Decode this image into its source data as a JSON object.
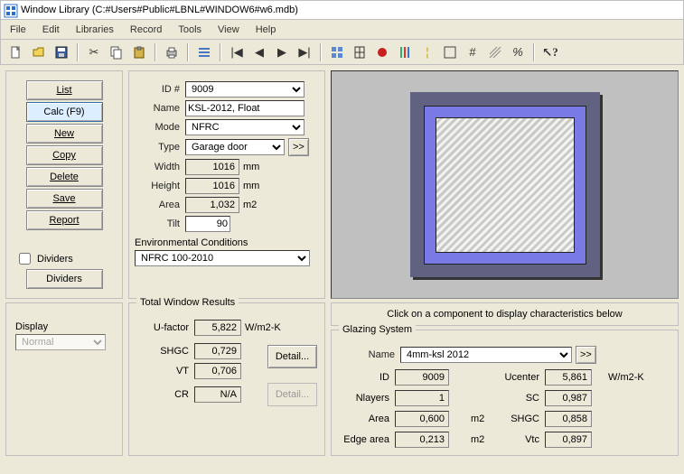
{
  "window": {
    "title": "Window Library (C:#Users#Public#LBNL#WINDOW6#w6.mdb)"
  },
  "menu": {
    "file": "File",
    "edit": "Edit",
    "libraries": "Libraries",
    "record": "Record",
    "tools": "Tools",
    "view": "View",
    "help": "Help"
  },
  "sidebar": {
    "list": "List",
    "calc": "Calc (F9)",
    "new": "New",
    "copy": "Copy",
    "delete": "Delete",
    "save": "Save",
    "report": "Report",
    "dividers_chk": "Dividers",
    "dividers_btn": "Dividers",
    "display_lbl": "Display",
    "display_val": "Normal"
  },
  "props": {
    "id_lbl": "ID #",
    "id_val": "9009",
    "name_lbl": "Name",
    "name_val": "KSL-2012, Float",
    "mode_lbl": "Mode",
    "mode_val": "NFRC",
    "type_lbl": "Type",
    "type_val": "Garage door",
    "more_btn": ">>",
    "width_lbl": "Width",
    "width_val": "1016",
    "width_unit": "mm",
    "height_lbl": "Height",
    "height_val": "1016",
    "height_unit": "mm",
    "area_lbl": "Area",
    "area_val": "1,032",
    "area_unit": "m2",
    "tilt_lbl": "Tilt",
    "tilt_val": "90",
    "env_lbl": "Environmental Conditions",
    "env_val": "NFRC 100-2010"
  },
  "results": {
    "title": "Total Window Results",
    "u_lbl": "U-factor",
    "u_val": "5,822",
    "u_unit": "W/m2-K",
    "shgc_lbl": "SHGC",
    "shgc_val": "0,729",
    "vt_lbl": "VT",
    "vt_val": "0,706",
    "cr_lbl": "CR",
    "cr_val": "N/A",
    "detail_btn": "Detail...",
    "detail_btn2": "Detail..."
  },
  "glazing": {
    "hint": "Click on a component to display characteristics below",
    "title": "Glazing System",
    "name_lbl": "Name",
    "name_val": "4mm-ksl 2012",
    "more_btn": ">>",
    "id_lbl": "ID",
    "id_val": "9009",
    "ucenter_lbl": "Ucenter",
    "ucenter_val": "5,861",
    "ucenter_unit": "W/m2-K",
    "nlayers_lbl": "Nlayers",
    "nlayers_val": "1",
    "sc_lbl": "SC",
    "sc_val": "0,987",
    "area_lbl": "Area",
    "area_val": "0,600",
    "area_unit": "m2",
    "shgc_lbl": "SHGC",
    "shgc_val": "0,858",
    "edge_lbl": "Edge area",
    "edge_val": "0,213",
    "edge_unit": "m2",
    "vtc_lbl": "Vtc",
    "vtc_val": "0,897"
  }
}
